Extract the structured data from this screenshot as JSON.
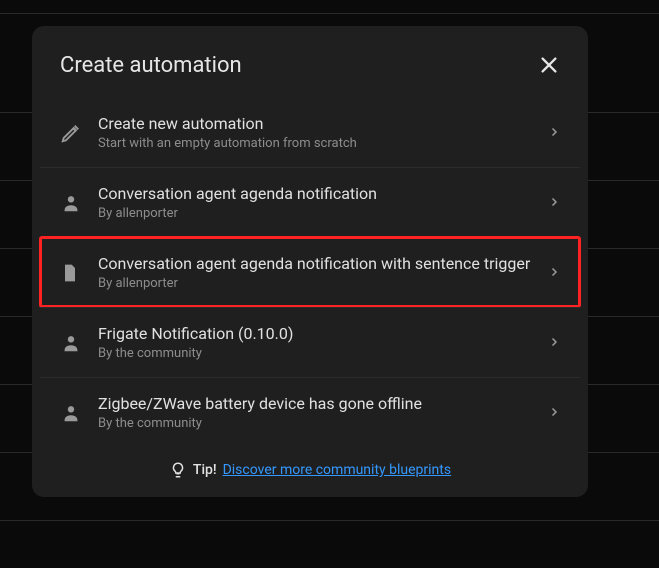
{
  "dialog": {
    "title": "Create automation"
  },
  "items": [
    {
      "icon": "pencil",
      "title": "Create new automation",
      "sub": "Start with an empty automation from scratch",
      "highlighted": false
    },
    {
      "icon": "person",
      "title": "Conversation agent agenda notification",
      "sub": "By allenporter",
      "highlighted": false
    },
    {
      "icon": "file",
      "title": "Conversation agent agenda notification with sentence trigger",
      "sub": "By allenporter",
      "highlighted": true
    },
    {
      "icon": "person",
      "title": "Frigate Notification (0.10.0)",
      "sub": "By the community",
      "highlighted": false
    },
    {
      "icon": "person",
      "title": "Zigbee/ZWave battery device has gone offline",
      "sub": "By the community",
      "highlighted": false
    }
  ],
  "tip": {
    "label": "Tip!",
    "link_text": "Discover more community blueprints"
  }
}
